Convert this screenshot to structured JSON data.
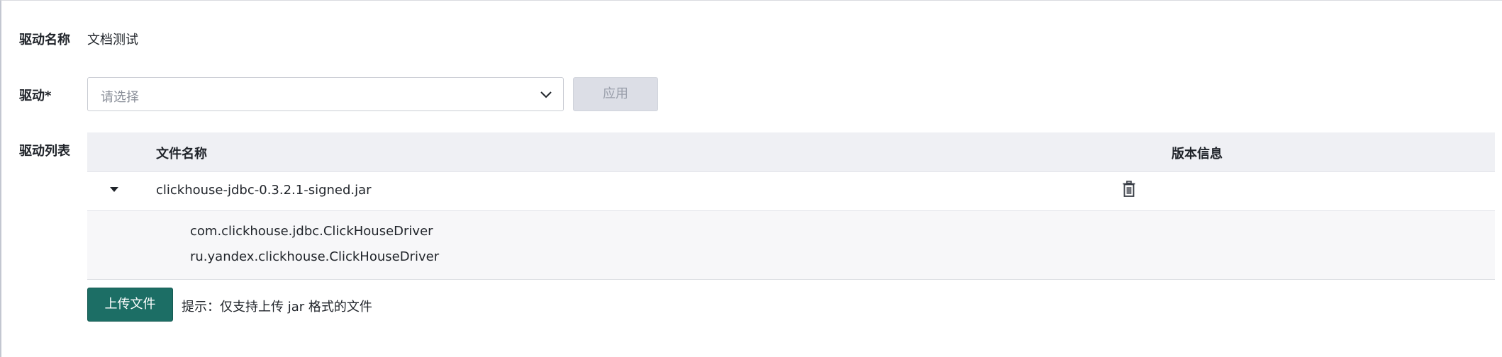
{
  "form": {
    "driver_name_label": "驱动名称",
    "driver_name_value": "文档测试",
    "driver_label": "驱动*",
    "driver_select_placeholder": "请选择",
    "apply_label": "应用",
    "driver_list_label": "驱动列表"
  },
  "table": {
    "columns": [
      "文件名称",
      "版本信息"
    ],
    "rows": [
      {
        "file_name": "clickhouse-jdbc-0.3.2.1-signed.jar",
        "expanded": true,
        "classes": [
          "com.clickhouse.jdbc.ClickHouseDriver",
          "ru.yandex.clickhouse.ClickHouseDriver"
        ]
      }
    ]
  },
  "upload": {
    "button_label": "上传文件",
    "hint": "提示：仅支持上传 jar 格式的文件"
  },
  "icons": {
    "select_arrow": "chevron-down-icon",
    "expand": "caret-down-icon",
    "delete": "trash-icon"
  },
  "colors": {
    "primary": "#1c6e65",
    "disabled_button_bg": "#dcdee6",
    "table_header_bg": "#eff0f4"
  }
}
